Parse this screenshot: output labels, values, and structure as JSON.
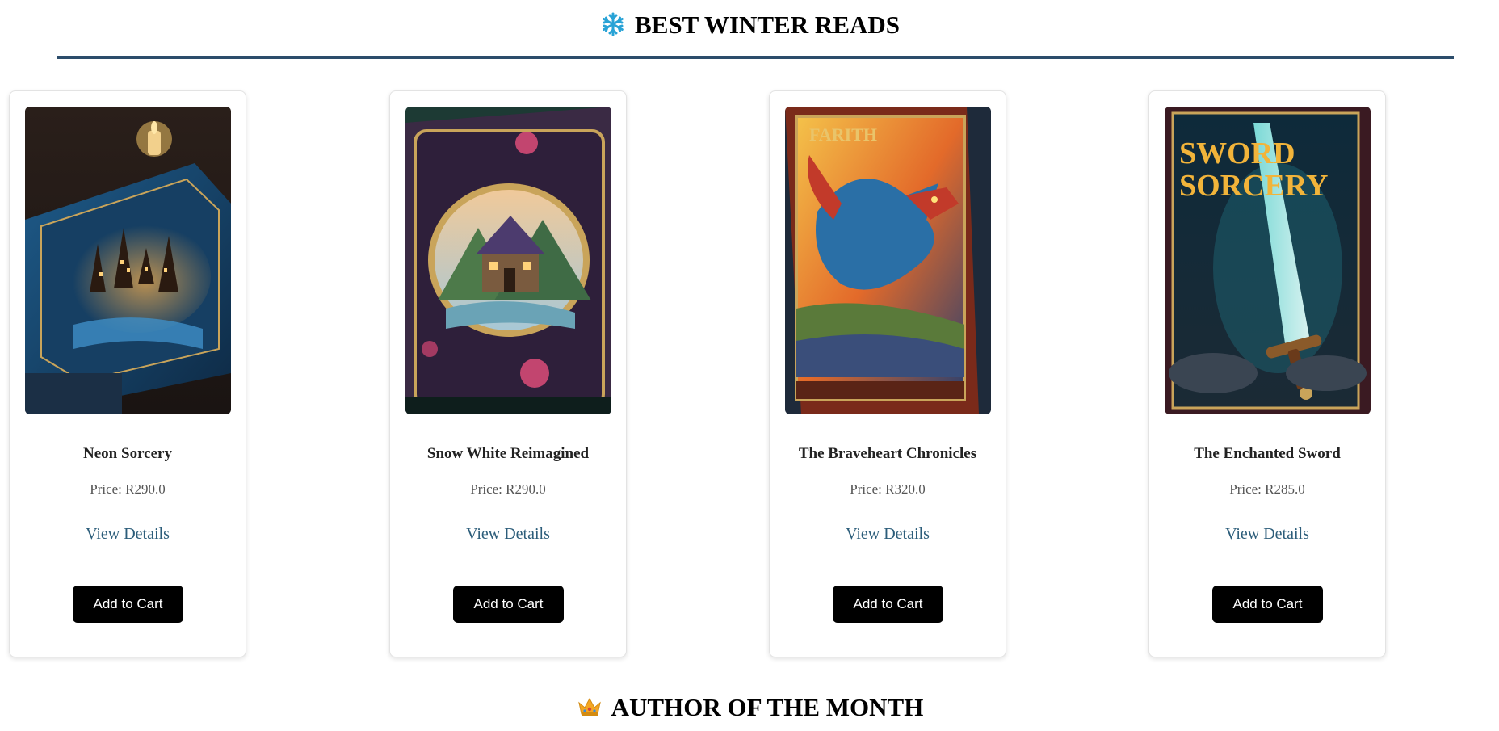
{
  "sections": {
    "winter": {
      "icon": "snowflake-icon",
      "title": "BEST WINTER READS"
    },
    "author": {
      "icon": "crown-icon",
      "title": "AUTHOR OF THE MONTH"
    }
  },
  "colors": {
    "divider": "#2c4d6b",
    "link": "#2c5d7a",
    "button": "#000000",
    "snowflake": "#29a3d6",
    "crown": "#f5a623"
  },
  "books": [
    {
      "title": "Neon Sorcery",
      "price": "Price: R290.0",
      "link": "View Details",
      "button": "Add to Cart",
      "cover_icon": "castle-book-cover-image"
    },
    {
      "title": "Snow White Reimagined",
      "price": "Price: R290.0",
      "link": "View Details",
      "button": "Add to Cart",
      "cover_icon": "cottage-book-cover-image"
    },
    {
      "title": "The Braveheart Chronicles",
      "price": "Price: R320.0",
      "link": "View Details",
      "button": "Add to Cart",
      "cover_icon": "dragon-book-cover-image"
    },
    {
      "title": "The Enchanted Sword",
      "price": "Price: R285.0",
      "link": "View Details",
      "button": "Add to Cart",
      "cover_icon": "sword-book-cover-image"
    }
  ]
}
